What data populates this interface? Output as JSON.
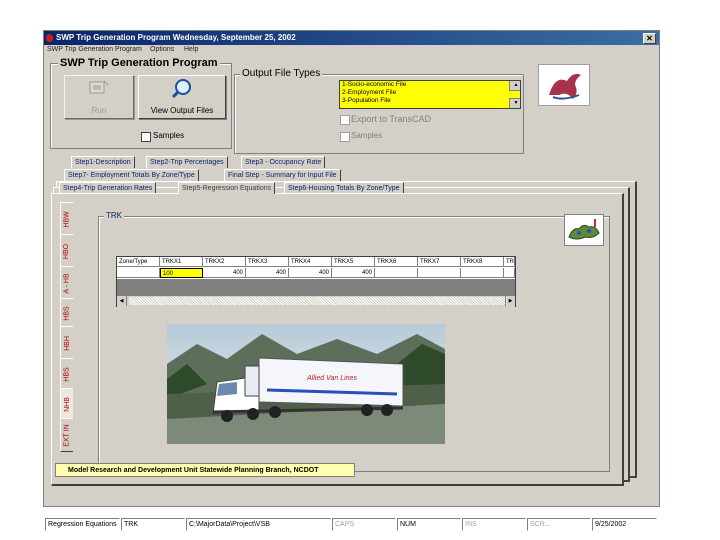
{
  "window": {
    "title": "SWP Trip Generation Program Wednesday, September 25, 2002",
    "close_glyph": "✕"
  },
  "menu": {
    "items": [
      "SWP Trip Generation Program",
      "Options",
      "Help"
    ]
  },
  "main_group": {
    "title": "SWP Trip Generation Program",
    "run_label": "Run",
    "view_output_label": "View Output Files",
    "samples_label": "Samples"
  },
  "output_group": {
    "title": "Output File Types",
    "files": [
      "1-Socio-economic File",
      "2-Employment File",
      "3-Population File"
    ],
    "export_label": "Export to TransCAD",
    "samples_label": "Samples"
  },
  "tabs": {
    "row1": [
      "Step1-Description",
      "Step2-Trip Percentages",
      "Step3 - Occupancy Rate"
    ],
    "row2": [
      "Step7- Employment Totals By Zone/Type",
      "Final Step - Summary for Input File"
    ],
    "row3": [
      "Step4-Trip Generation Rates",
      "Step5-Regression Equations",
      "Step6-Housing Totals By Zone/Type"
    ]
  },
  "side_tabs": [
    "HBW",
    "HBO",
    "A - HB",
    "HBS",
    "HBH",
    "HBS",
    "NHB",
    "EXT IN"
  ],
  "trk_panel": {
    "title": "TRK",
    "columns": [
      "Zone/Type",
      "TRKX1",
      "TRKX2",
      "TRKX3",
      "TRKX4",
      "TRKX5",
      "TRKX6",
      "TRKX7",
      "TRKX8",
      "TRKX9"
    ],
    "row": [
      "",
      "100",
      "400",
      "400",
      "400",
      "400",
      "",
      "",
      "",
      ""
    ]
  },
  "footer_note": "Model Research and Development Unit Statewide Planning Branch, NCDOT",
  "status_bar": [
    "Regression Equations",
    "TRK",
    "C:\\MajorData\\Project\\VSB",
    "CAPS",
    "NUM",
    "INS",
    "SCR...",
    "9/25/2002"
  ],
  "colors": {
    "title_start": "#0a246a",
    "title_end": "#3a6ea5",
    "face": "#d4d0c8",
    "highlight": "#ffff00"
  },
  "icons": {
    "run": "run-icon",
    "view": "magnifier-icon",
    "logo": "bird-logo-icon",
    "map": "map-icon"
  }
}
